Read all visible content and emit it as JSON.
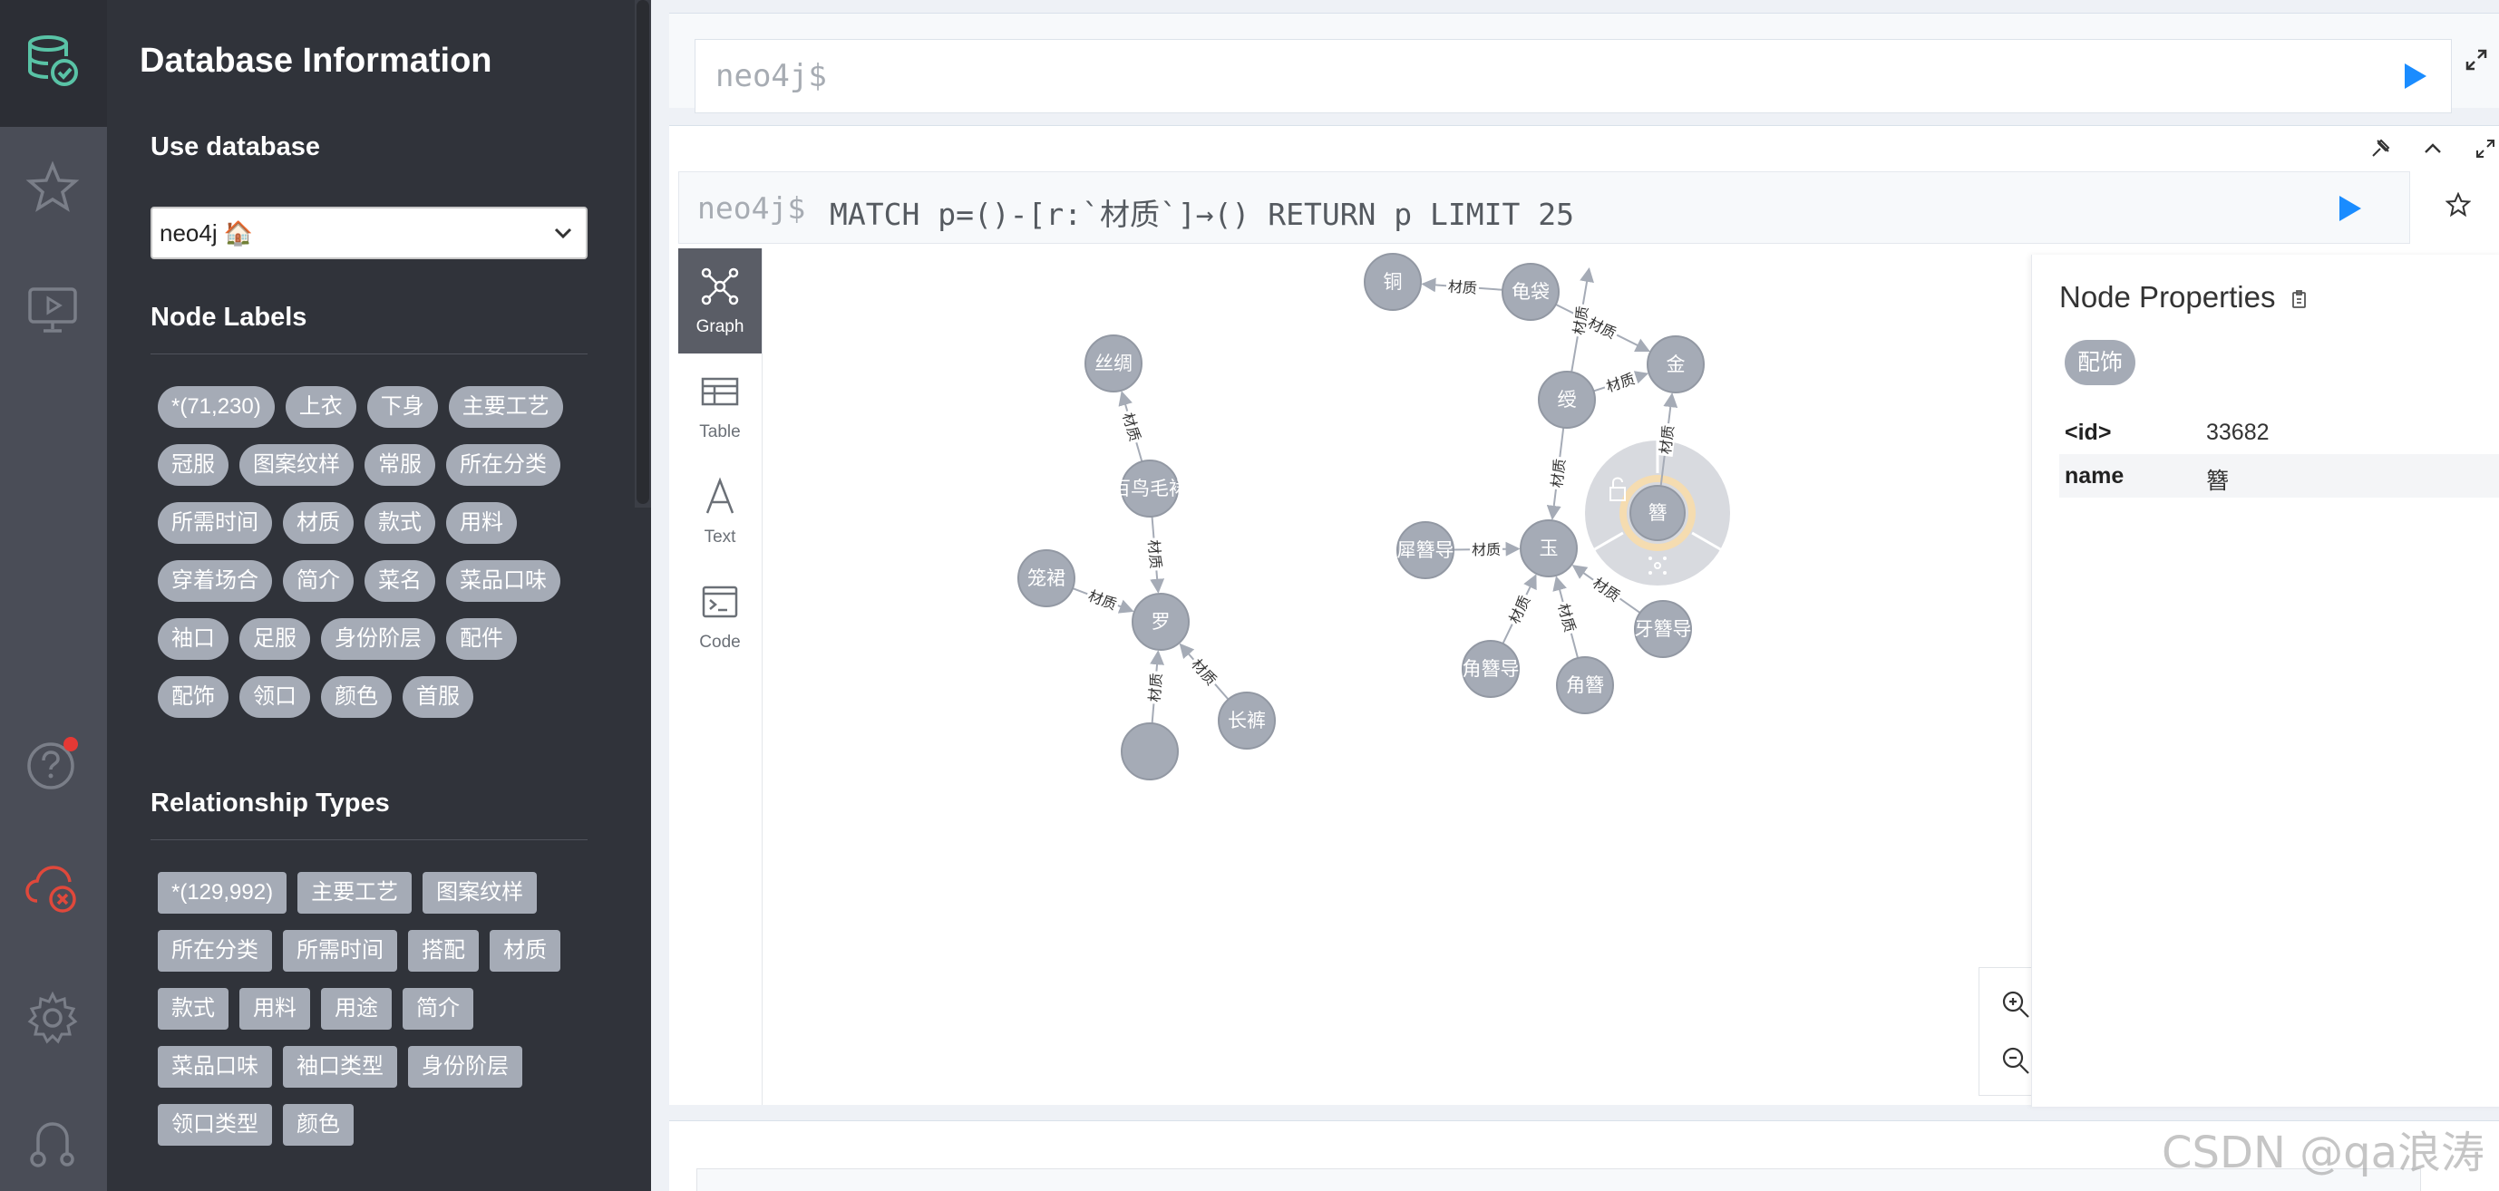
{
  "app": {
    "drawer_title": "Database Information",
    "use_database_label": "Use database",
    "selected_database": "neo4j 🏠",
    "node_labels_title": "Node Labels",
    "node_labels": [
      "*(71,230)",
      "上衣",
      "下身",
      "主要工艺",
      "冠服",
      "图案纹样",
      "常服",
      "所在分类",
      "所需时间",
      "材质",
      "款式",
      "用料",
      "穿着场合",
      "简介",
      "菜名",
      "菜品口味",
      "袖口",
      "足服",
      "身份阶层",
      "配件",
      "配饰",
      "领口",
      "颜色",
      "首服"
    ],
    "relationship_types_title": "Relationship Types",
    "relationship_types": [
      "*(129,992)",
      "主要工艺",
      "图案纹样",
      "所在分类",
      "所需时间",
      "搭配",
      "材质",
      "款式",
      "用料",
      "用途",
      "简介",
      "菜品口味",
      "袖口类型",
      "身份阶层",
      "领口类型",
      "颜色"
    ]
  },
  "rail": {
    "icons": [
      "database-icon",
      "favorites-star-icon",
      "guides-monitor-icon",
      "help-icon",
      "disconnected-cloud-icon",
      "settings-gear-icon",
      "about-neo4j-icon"
    ],
    "help_notification_color": "#e53935",
    "disconnected_color": "#e0483b"
  },
  "editor": {
    "prompt": "neo4j$"
  },
  "frame": {
    "prompt": "neo4j$",
    "query": "MATCH p=()-[r:`材质`]→() RETURN p LIMIT 25",
    "view_tabs": [
      {
        "label": "Graph",
        "icon": "graph-icon",
        "active": true
      },
      {
        "label": "Table",
        "icon": "table-icon",
        "active": false
      },
      {
        "label": "Text",
        "icon": "text-icon",
        "active": false
      },
      {
        "label": "Code",
        "icon": "code-icon",
        "active": false
      }
    ]
  },
  "graph": {
    "node_color": "#a5abb6",
    "edge_color": "#a5abb6",
    "selected_ring_color": "#f5dcb0",
    "nodes": [
      {
        "id": "n_tong",
        "label": "铜"
      },
      {
        "id": "n_guidai",
        "label": "龟袋"
      },
      {
        "id": "n_jin",
        "label": "金"
      },
      {
        "id": "n_shou",
        "label": "绶"
      },
      {
        "id": "n_sichou",
        "label": "丝绸"
      },
      {
        "id": "n_bainiao",
        "label": "百鸟毛裙"
      },
      {
        "id": "n_longqun",
        "label": "笼裙"
      },
      {
        "id": "n_luo",
        "label": "罗"
      },
      {
        "id": "n_changku",
        "label": "长裤"
      },
      {
        "id": "n_bottom",
        "label": ""
      },
      {
        "id": "n_xibi",
        "label": "犀簪导"
      },
      {
        "id": "n_yu",
        "label": "玉"
      },
      {
        "id": "n_zan",
        "label": "簪"
      },
      {
        "id": "n_yazan",
        "label": "牙簪导"
      },
      {
        "id": "n_jiaozandao",
        "label": "角簪导"
      },
      {
        "id": "n_jiaozan",
        "label": "角簪"
      }
    ],
    "edges": [
      {
        "from": "n_guidai",
        "to": "n_tong",
        "label": "材质"
      },
      {
        "from": "n_guidai",
        "to": "n_jin",
        "label": "材质"
      },
      {
        "from": "n_shou",
        "to": "n_jin",
        "label": "材质"
      },
      {
        "from": "n_shou",
        "to": "n_top",
        "label": "材质"
      },
      {
        "from": "n_shou",
        "to": "n_yu",
        "label": "材质"
      },
      {
        "from": "n_zan",
        "to": "n_jin",
        "label": "材质"
      },
      {
        "from": "n_bainiao",
        "to": "n_sichou",
        "label": "材质"
      },
      {
        "from": "n_bainiao",
        "to": "n_luo",
        "label": "材质"
      },
      {
        "from": "n_longqun",
        "to": "n_luo",
        "label": "材质"
      },
      {
        "from": "n_changku",
        "to": "n_luo",
        "label": "材质"
      },
      {
        "from": "n_bottom",
        "to": "n_luo",
        "label": "材质"
      },
      {
        "from": "n_xibi",
        "to": "n_yu",
        "label": "材质"
      },
      {
        "from": "n_yazan",
        "to": "n_yu",
        "label": "材质"
      },
      {
        "from": "n_jiaozandao",
        "to": "n_yu",
        "label": "材质"
      },
      {
        "from": "n_jiaozan",
        "to": "n_yu",
        "label": "材质"
      }
    ]
  },
  "properties": {
    "title": "Node Properties",
    "copy_icon": "clipboard-icon",
    "label_badge": "配饰",
    "rows": [
      {
        "key": "<id>",
        "value": "33682"
      },
      {
        "key": "name",
        "value": "簪"
      }
    ]
  },
  "watermark": "CSDN @qa浪涛"
}
